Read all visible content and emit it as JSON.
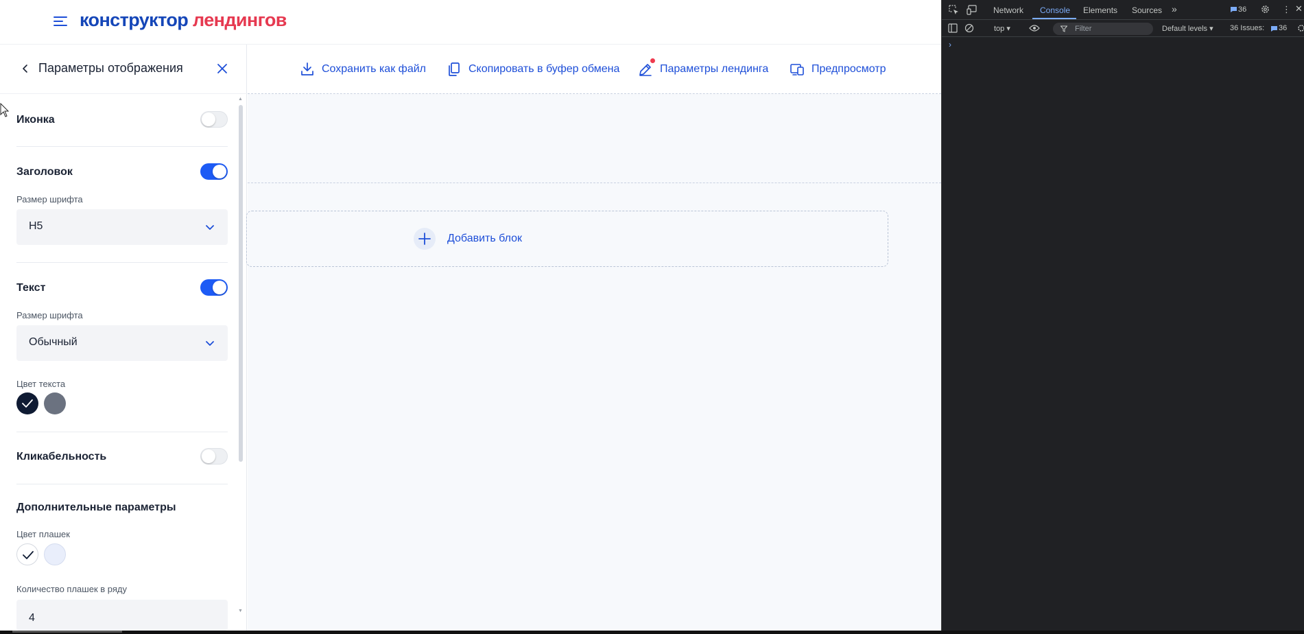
{
  "header": {
    "logo_part1": "конструктор",
    "logo_part2": "лендингов"
  },
  "panel": {
    "title": "Параметры отображения",
    "icon_section": {
      "label": "Иконка",
      "enabled": false
    },
    "heading_section": {
      "label": "Заголовок",
      "enabled": true,
      "font_size_label": "Размер шрифта",
      "font_size_value": "H5"
    },
    "text_section": {
      "label": "Текст",
      "enabled": true,
      "font_size_label": "Размер шрифта",
      "font_size_value": "Обычный",
      "color_label": "Цвет текста"
    },
    "clickable_section": {
      "label": "Кликабельность",
      "enabled": false
    },
    "extra_section": {
      "label": "Дополнительные параметры",
      "plate_color_label": "Цвет плашек",
      "plates_per_row_label": "Количество плашек в ряду",
      "plates_per_row_value": "4"
    },
    "colors": {
      "text_dark": "#0f1b33",
      "text_gray": "#6b7280",
      "plate_white": "#ffffff",
      "plate_light": "#e9eefb"
    }
  },
  "toolbar": {
    "save_file": "Сохранить как файл",
    "copy_clipboard": "Скопировать в буфер обмена",
    "landing_params": "Параметры лендинга",
    "preview": "Предпросмотр"
  },
  "canvas": {
    "add_block": "Добавить блок"
  },
  "devtools": {
    "tabs": [
      "Network",
      "Console",
      "Elements",
      "Sources"
    ],
    "active_tab": "Console",
    "messages_count": "36",
    "context": "top",
    "filter_placeholder": "Filter",
    "levels": "Default levels",
    "issues_label": "36 Issues:",
    "issues_count": "36",
    "prompt": "›"
  },
  "accent": "#1d4ed8",
  "brand_red": "#e63950"
}
